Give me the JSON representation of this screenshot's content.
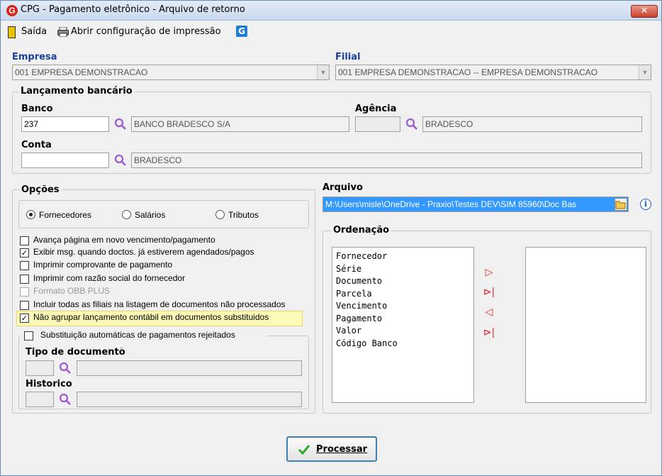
{
  "window": {
    "title": "CPG - Pagamento eletrônico - Arquivo de retorno",
    "close_label": "✕"
  },
  "toolbar": {
    "exit_label": "Saída",
    "print_config_label": "Abrir configuração de impressão"
  },
  "empresa": {
    "label": "Empresa",
    "value": "001 EMPRESA DEMONSTRACAO"
  },
  "filial": {
    "label": "Filial",
    "value": "001 EMPRESA DEMONSTRACAO -- EMPRESA DEMONSTRACAO"
  },
  "lancamento": {
    "title": "Lançamento bancário",
    "banco_label": "Banco",
    "banco_code": "237",
    "banco_name": "BANCO BRADESCO S/A",
    "agencia_label": "Agência",
    "agencia_code": "",
    "agencia_name": "BRADESCO",
    "conta_label": "Conta",
    "conta_code": "",
    "conta_name": "BRADESCO"
  },
  "opcoes": {
    "title": "Opções",
    "radios": [
      {
        "label": "Fornecedores",
        "checked": true
      },
      {
        "label": "Salários",
        "checked": false
      },
      {
        "label": "Tributos",
        "checked": false
      }
    ],
    "checks": [
      {
        "label": "Avança página em novo vencimento/pagamento",
        "checked": false
      },
      {
        "label": "Exibir msg. quando doctos. já estiverem agendados/pagos",
        "checked": true
      },
      {
        "label": "Imprimir comprovante de pagamento",
        "checked": false
      },
      {
        "label": "Imprimir com razão social do fornecedor",
        "checked": false
      },
      {
        "label": "Formato OBB PLUS",
        "checked": false
      },
      {
        "label": "Incluir todas as filiais na listagem de documentos não processados",
        "checked": false
      },
      {
        "label": "Não agrupar lançamento contábil em documentos substituidos",
        "checked": true
      }
    ],
    "highlight_color": "#fdfab8"
  },
  "substituicao": {
    "label": "Substituição automáticas de pagamentos rejeitados",
    "tipo_label": "Tipo de documento",
    "historico_label": "Historico"
  },
  "arquivo": {
    "label": "Arquivo",
    "value": "M:\\Users\\misle\\OneDrive - Praxio\\Testes DEV\\SIM 85960\\Doc Bas"
  },
  "ordenacao": {
    "title": "Ordenação",
    "items": [
      "Fornecedor",
      "Série",
      "Documento",
      "Parcela",
      "Vencimento",
      "Pagamento",
      "Valor",
      "Código Banco"
    ],
    "arrows": [
      "▷",
      "⊳|",
      "◁",
      "⊳|"
    ]
  },
  "processar_label": "Processar",
  "colors": {
    "accent_blue": "#1a3f9e",
    "selection": "#3399ff",
    "check_green": "#2ea82e",
    "arrow_red": "#e02020",
    "search_purple": "#9b59d0"
  }
}
